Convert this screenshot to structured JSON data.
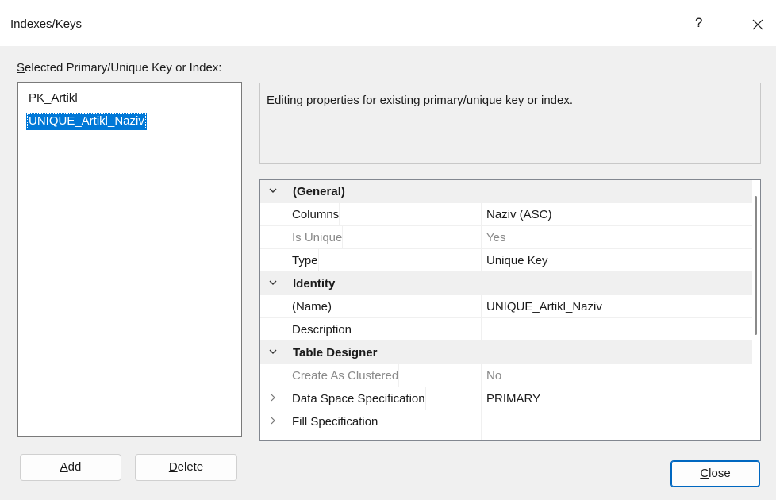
{
  "window": {
    "title": "Indexes/Keys",
    "help_label": "?",
    "close_icon": "close-icon"
  },
  "list": {
    "label_accel": "S",
    "label_rest": "elected Primary/Unique Key or Index:",
    "items": [
      {
        "label": "PK_Artikl",
        "selected": false
      },
      {
        "label": "UNIQUE_Artikl_Naziv",
        "selected": true
      }
    ]
  },
  "description": {
    "text": "Editing properties for existing primary/unique key or index."
  },
  "properties": {
    "rows": [
      {
        "kind": "category",
        "name": "(General)",
        "expanded": true
      },
      {
        "kind": "prop",
        "name": "Columns",
        "value": "Naziv (ASC)",
        "readonly": false
      },
      {
        "kind": "prop",
        "name": "Is Unique",
        "value": "Yes",
        "readonly": true
      },
      {
        "kind": "prop",
        "name": "Type",
        "value": "Unique Key",
        "readonly": false
      },
      {
        "kind": "category",
        "name": "Identity",
        "expanded": true
      },
      {
        "kind": "prop",
        "name": "(Name)",
        "value": "UNIQUE_Artikl_Naziv",
        "readonly": false
      },
      {
        "kind": "prop",
        "name": "Description",
        "value": "",
        "readonly": false
      },
      {
        "kind": "category",
        "name": "Table Designer",
        "expanded": true
      },
      {
        "kind": "prop",
        "name": "Create As Clustered",
        "value": "No",
        "readonly": true
      },
      {
        "kind": "prop",
        "name": "Data Space Specification",
        "value": "PRIMARY",
        "readonly": false,
        "expandable": true
      },
      {
        "kind": "prop",
        "name": "Fill Specification",
        "value": "",
        "readonly": false,
        "expandable": true
      }
    ]
  },
  "buttons": {
    "add": {
      "accel": "A",
      "rest": "dd"
    },
    "delete": {
      "accel": "D",
      "rest": "elete"
    },
    "close": {
      "accel": "C",
      "rest": "lose"
    }
  }
}
